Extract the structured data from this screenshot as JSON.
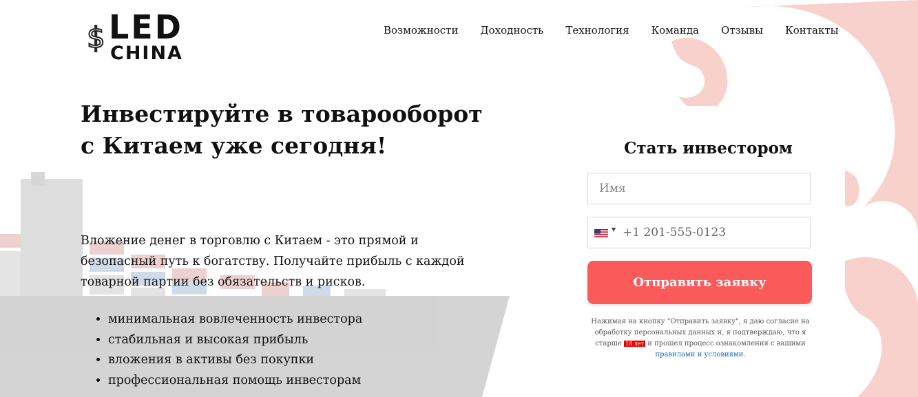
{
  "header": {
    "logo": {
      "dollar": "$",
      "line1": "LED",
      "line2": "CHINA"
    },
    "nav": [
      {
        "label": "Возможности"
      },
      {
        "label": "Доходность"
      },
      {
        "label": "Технология"
      },
      {
        "label": "Команда"
      },
      {
        "label": "Отзывы"
      },
      {
        "label": "Контакты"
      }
    ]
  },
  "hero": {
    "title": "Инвестируйте в товарооборот с Китаем уже сегодня!",
    "description": "Вложение денег в торговлю с Китаем - это прямой и безопасный путь к богатству. Получайте прибыль с каждой товарной партии без обязательств и рисков.",
    "benefits": [
      "минимальная вовлеченность инвестора",
      "стабильная и высокая прибыль",
      "вложения в активы без покупки",
      "профессиональная помощь инвесторам"
    ]
  },
  "form": {
    "title": "Стать инвестором",
    "name_placeholder": "Имя",
    "name_value": "",
    "phone_country": "us-flag-icon",
    "phone_placeholder": "+1 201-555-0123",
    "phone_value": "",
    "submit_label": "Отправить заявку",
    "consent": {
      "before": "Нажимая на кнопку \"Отправить заявку\", я даю согласие на обработку персональных данных и, я подтверждаю, что я старше ",
      "age": "18 лет",
      "middle": " и прошел процесс ознакомления с вашими ",
      "link": "правилами и условиями",
      "after": "."
    }
  },
  "colors": {
    "accent": "#fa5a5a",
    "badge": "#e60000",
    "link": "#1565c0",
    "text": "#111111"
  }
}
